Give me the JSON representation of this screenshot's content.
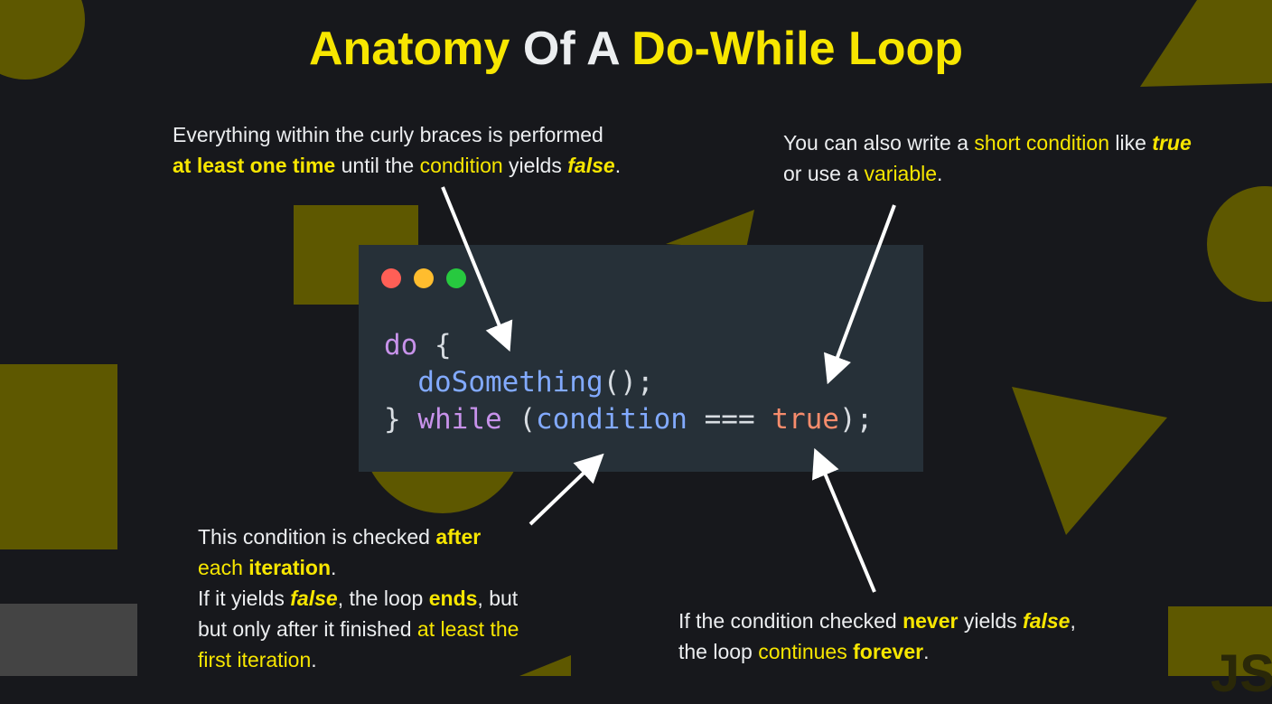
{
  "title": {
    "part1": "Anatomy ",
    "part2": "Of A ",
    "part3": "Do-While Loop"
  },
  "notes": {
    "top_left": [
      [
        {
          "t": "Everything within the curly braces is performed",
          "c": ""
        }
      ],
      [
        {
          "t": "at least one time",
          "c": "y b"
        },
        {
          "t": " until the ",
          "c": ""
        },
        {
          "t": "condition",
          "c": "y"
        },
        {
          "t": " yields ",
          "c": ""
        },
        {
          "t": "false",
          "c": "y b i"
        },
        {
          "t": ".",
          "c": ""
        }
      ]
    ],
    "top_right": [
      [
        {
          "t": "You can also write a ",
          "c": ""
        },
        {
          "t": "short condition",
          "c": "y"
        },
        {
          "t": " like ",
          "c": ""
        },
        {
          "t": "true",
          "c": "y b i"
        }
      ],
      [
        {
          "t": "or use a ",
          "c": ""
        },
        {
          "t": "variable",
          "c": "y"
        },
        {
          "t": ".",
          "c": ""
        }
      ]
    ],
    "bottom_left": [
      [
        {
          "t": "This condition is checked ",
          "c": ""
        },
        {
          "t": "after",
          "c": "y b"
        }
      ],
      [
        {
          "t": "each ",
          "c": "y"
        },
        {
          "t": "iteration",
          "c": "y b"
        },
        {
          "t": ".",
          "c": ""
        }
      ],
      [
        {
          "t": "If it yields ",
          "c": ""
        },
        {
          "t": "false",
          "c": "y b i"
        },
        {
          "t": ", the loop ",
          "c": ""
        },
        {
          "t": "ends",
          "c": "y b"
        },
        {
          "t": ", but",
          "c": ""
        }
      ],
      [
        {
          "t": "but only after it finished ",
          "c": ""
        },
        {
          "t": "at least the",
          "c": "y"
        }
      ],
      [
        {
          "t": "first iteration",
          "c": "y"
        },
        {
          "t": ".",
          "c": ""
        }
      ]
    ],
    "bottom_right": [
      [
        {
          "t": "If the condition checked ",
          "c": ""
        },
        {
          "t": "never",
          "c": "y b"
        },
        {
          "t": " yields ",
          "c": ""
        },
        {
          "t": "false",
          "c": "y b i"
        },
        {
          "t": ",",
          "c": ""
        }
      ],
      [
        {
          "t": "the loop ",
          "c": ""
        },
        {
          "t": "continues",
          "c": "y"
        },
        {
          "t": " ",
          "c": ""
        },
        {
          "t": "forever",
          "c": "y b"
        },
        {
          "t": ".",
          "c": ""
        }
      ]
    ]
  },
  "code": [
    [
      {
        "t": "do",
        "k": "kw"
      },
      {
        "t": " {",
        "k": "p"
      }
    ],
    [
      {
        "t": "  doSomething",
        "k": "fn"
      },
      {
        "t": "();",
        "k": "p"
      }
    ],
    [
      {
        "t": "} ",
        "k": "p"
      },
      {
        "t": "while",
        "k": "kw"
      },
      {
        "t": " (",
        "k": "p"
      },
      {
        "t": "condition",
        "k": "fn"
      },
      {
        "t": " === ",
        "k": "p"
      },
      {
        "t": "true",
        "k": "bool"
      },
      {
        "t": ");",
        "k": "p"
      }
    ]
  ],
  "logo": "JS",
  "colors": {
    "accent": "#f7e600",
    "shape": "#5e5800",
    "panel": "#263038",
    "kw": "#c792ea",
    "fn": "#82aaff",
    "bool": "#f78c6c",
    "p": "#d8dde2"
  }
}
